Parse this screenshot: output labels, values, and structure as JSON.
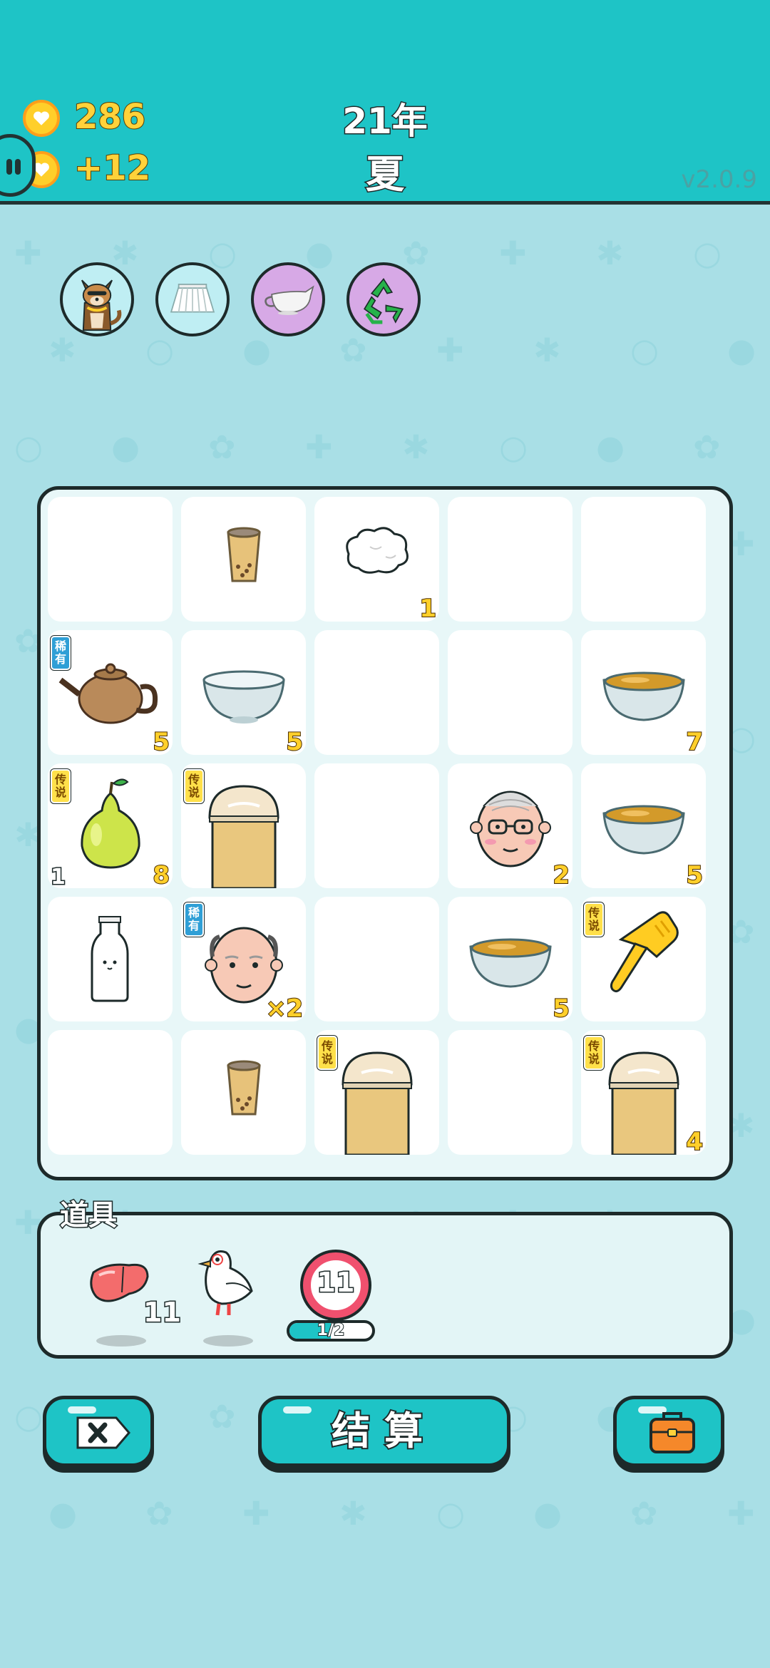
{
  "header": {
    "coins": "286",
    "coin_rate": "+12",
    "year": "21年",
    "season": "夏",
    "version": "v2.0.9"
  },
  "buffs": [
    {
      "name": "shiba-dog",
      "bg": "#bfeef3"
    },
    {
      "name": "pleated-skirt",
      "bg": "#bfeef3"
    },
    {
      "name": "milk-jug",
      "bg": "#d7a9e6"
    },
    {
      "name": "recycle",
      "bg": "#d7a9e6"
    }
  ],
  "grid": [
    {
      "item": "",
      "badge": "",
      "count": "",
      "left_count": ""
    },
    {
      "item": "boba-cup-small",
      "badge": "",
      "count": "",
      "left_count": ""
    },
    {
      "item": "cotton",
      "badge": "",
      "count": "1",
      "left_count": ""
    },
    {
      "item": "",
      "badge": "",
      "count": "",
      "left_count": ""
    },
    {
      "item": "",
      "badge": "",
      "count": "",
      "left_count": ""
    },
    {
      "item": "teapot",
      "badge": "稀有",
      "count": "5",
      "left_count": ""
    },
    {
      "item": "empty-bowl",
      "badge": "",
      "count": "5",
      "left_count": ""
    },
    {
      "item": "",
      "badge": "",
      "count": "",
      "left_count": ""
    },
    {
      "item": "",
      "badge": "",
      "count": "",
      "left_count": ""
    },
    {
      "item": "tea-bowl",
      "badge": "",
      "count": "7",
      "left_count": ""
    },
    {
      "item": "pear",
      "badge": "传说",
      "count": "8",
      "left_count": "1"
    },
    {
      "item": "boba-cup-large",
      "badge": "传说",
      "count": "",
      "left_count": ""
    },
    {
      "item": "",
      "badge": "",
      "count": "",
      "left_count": ""
    },
    {
      "item": "old-man-face",
      "badge": "",
      "count": "2",
      "left_count": ""
    },
    {
      "item": "tea-bowl",
      "badge": "",
      "count": "5",
      "left_count": ""
    },
    {
      "item": "milk-bottle",
      "badge": "",
      "count": "",
      "left_count": ""
    },
    {
      "item": "bald-face",
      "badge": "稀有",
      "count": "×2",
      "left_count": ""
    },
    {
      "item": "",
      "badge": "",
      "count": "",
      "left_count": ""
    },
    {
      "item": "tea-bowl",
      "badge": "",
      "count": "5",
      "left_count": ""
    },
    {
      "item": "pointing-hand",
      "badge": "传说",
      "count": "",
      "left_count": ""
    },
    {
      "item": "",
      "badge": "",
      "count": "",
      "left_count": ""
    },
    {
      "item": "boba-cup-small",
      "badge": "",
      "count": "",
      "left_count": ""
    },
    {
      "item": "boba-cup-large",
      "badge": "传说",
      "count": "",
      "left_count": ""
    },
    {
      "item": "",
      "badge": "",
      "count": "",
      "left_count": ""
    },
    {
      "item": "boba-cup-large",
      "badge": "传说",
      "count": "4",
      "left_count": ""
    }
  ],
  "props": {
    "title": "道具",
    "liver_count": "11",
    "timer_value": "11",
    "timer_progress": "1/2",
    "timer_fraction": 0.5
  },
  "buttons": {
    "settle": "结算"
  }
}
